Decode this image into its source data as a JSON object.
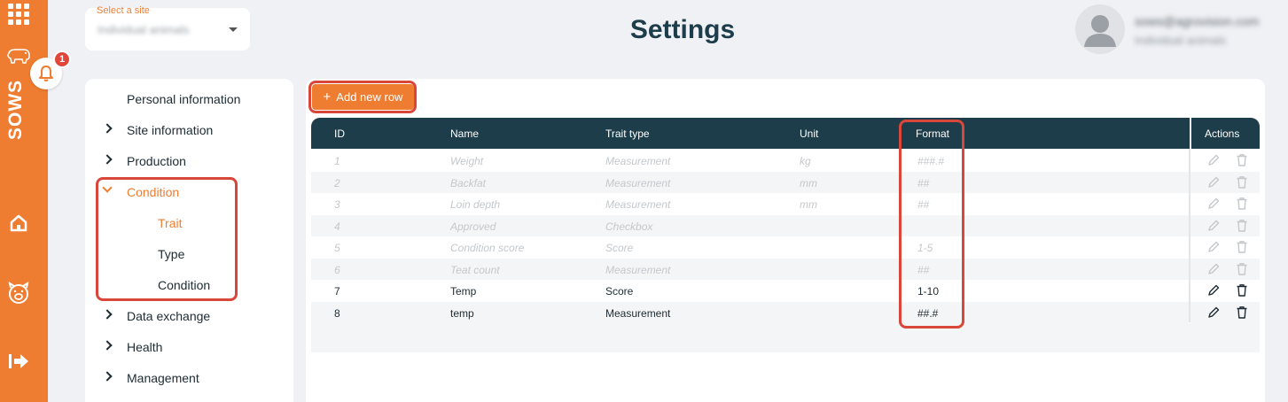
{
  "rail": {
    "brand": "SOWS",
    "icons": [
      "apps-grid-icon",
      "pig-icon",
      "home-icon",
      "pig-face-icon",
      "logout-icon"
    ]
  },
  "notifications": {
    "count": "1"
  },
  "site_select": {
    "label": "Select a site",
    "value": "Individual animals"
  },
  "page": {
    "title": "Settings"
  },
  "user": {
    "email": "sows@agrovision.com",
    "subtitle": "Individual animals"
  },
  "nav": {
    "items": [
      {
        "label": "Personal information"
      },
      {
        "label": "Site information"
      },
      {
        "label": "Production"
      },
      {
        "label": "Condition",
        "expanded": true
      },
      {
        "label": "Data exchange"
      },
      {
        "label": "Health"
      },
      {
        "label": "Management"
      }
    ],
    "sub_items": [
      {
        "label": "Trait",
        "selected": true
      },
      {
        "label": "Type"
      },
      {
        "label": "Condition"
      }
    ]
  },
  "toolbar": {
    "add_label": "Add new row",
    "add_symbol": "+"
  },
  "table": {
    "headers": {
      "id": "ID",
      "name": "Name",
      "trait_type": "Trait type",
      "unit": "Unit",
      "format": "Format",
      "actions": "Actions"
    },
    "rows": [
      {
        "id": "1",
        "name": "Weight",
        "trait_type": "Measurement",
        "unit": "kg",
        "format": "###.#",
        "enabled": false
      },
      {
        "id": "2",
        "name": "Backfat",
        "trait_type": "Measurement",
        "unit": "mm",
        "format": "##",
        "enabled": false
      },
      {
        "id": "3",
        "name": "Loin depth",
        "trait_type": "Measurement",
        "unit": "mm",
        "format": "##",
        "enabled": false
      },
      {
        "id": "4",
        "name": "Approved",
        "trait_type": "Checkbox",
        "unit": "",
        "format": "",
        "enabled": false
      },
      {
        "id": "5",
        "name": "Condition score",
        "trait_type": "Score",
        "unit": "",
        "format": "1-5",
        "enabled": false
      },
      {
        "id": "6",
        "name": "Teat count",
        "trait_type": "Measurement",
        "unit": "",
        "format": "##",
        "enabled": false
      },
      {
        "id": "7",
        "name": "Temp",
        "trait_type": "Score",
        "unit": "",
        "format": "1-10",
        "enabled": true
      },
      {
        "id": "8",
        "name": "temp",
        "trait_type": "Measurement",
        "unit": "",
        "format": "##.#",
        "enabled": true
      }
    ]
  },
  "colors": {
    "accent": "#ee7d31",
    "header": "#1d3d4a",
    "highlight": "#d8473a"
  }
}
